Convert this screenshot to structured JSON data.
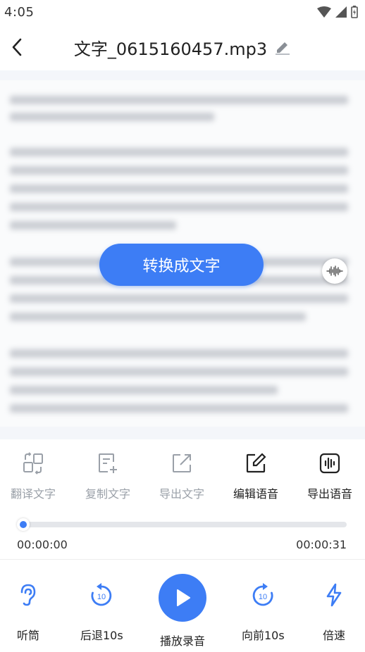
{
  "status_bar": {
    "time": "4:05"
  },
  "header": {
    "title": "文字_0615160457.mp3"
  },
  "content": {
    "convert_label": "转换成文字"
  },
  "toolbar": {
    "items": [
      {
        "label": "翻译文字",
        "icon": "translate-icon",
        "enabled": false
      },
      {
        "label": "复制文字",
        "icon": "copy-text-icon",
        "enabled": false
      },
      {
        "label": "导出文字",
        "icon": "export-text-icon",
        "enabled": false
      },
      {
        "label": "编辑语音",
        "icon": "edit-audio-icon",
        "enabled": true
      },
      {
        "label": "导出语音",
        "icon": "export-audio-icon",
        "enabled": true
      }
    ]
  },
  "player": {
    "current_time": "00:00:00",
    "total_time": "00:00:31",
    "progress": 0.0
  },
  "controls": {
    "earpiece_label": "听筒",
    "rewind_label": "后退10s",
    "play_label": "播放录音",
    "forward_label": "向前10s",
    "speed_label": "倍速",
    "skip_seconds": "10"
  },
  "colors": {
    "accent": "#3d7df5",
    "disabled": "#9aa0a8"
  }
}
